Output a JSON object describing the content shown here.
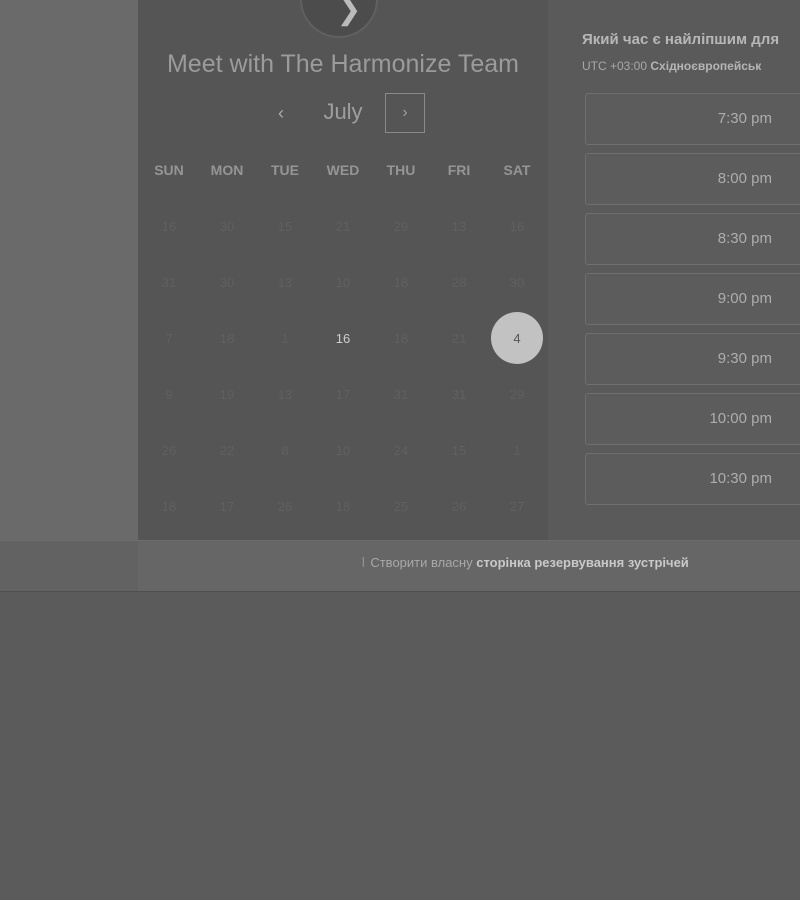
{
  "calendar": {
    "title": "Meet with The Harmonize Team",
    "month": "July",
    "prev_glyph": "‹",
    "next_glyph": "›",
    "weekdays": [
      "SUN",
      "MON",
      "TUE",
      "WED",
      "THU",
      "FRI",
      "SAT"
    ],
    "weeks": [
      [
        "16",
        "30",
        "15",
        "21",
        "29",
        "13",
        "16"
      ],
      [
        "31",
        "30",
        "13",
        "10",
        "18",
        "28",
        "30"
      ],
      [
        "7",
        "18",
        "1",
        "16",
        "18",
        "21",
        "4"
      ],
      [
        "9",
        "19",
        "13",
        "17",
        "31",
        "31",
        "29"
      ],
      [
        "26",
        "22",
        "8",
        "10",
        "24",
        "15",
        "1"
      ],
      [
        "18",
        "17",
        "26",
        "18",
        "25",
        "26",
        "27"
      ]
    ],
    "available_day": "16",
    "selected_day": "4"
  },
  "times": {
    "heading": "Який час є найліпшим для",
    "timezone_offset": "UTC +03:00",
    "timezone_name": "Східноєвропейськ",
    "slots": [
      "7:30 pm",
      "8:00 pm",
      "8:30 pm",
      "9:00 pm",
      "9:30 pm",
      "10:00 pm",
      "10:30 pm"
    ]
  },
  "footer": {
    "prefix": "Створити власну",
    "link": "сторінка резервування зустрічей"
  }
}
